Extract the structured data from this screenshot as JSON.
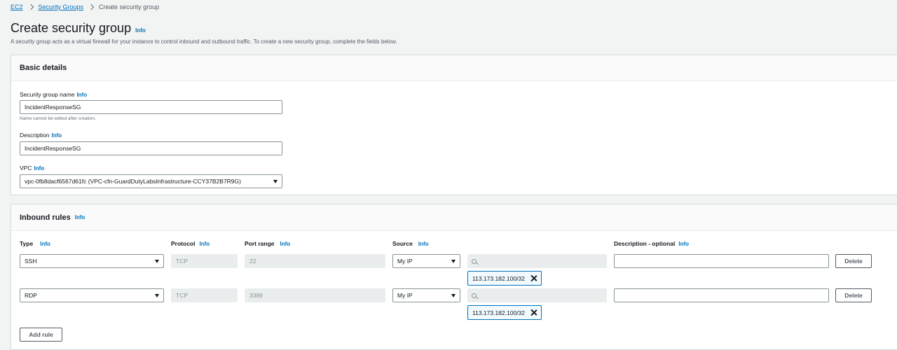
{
  "breadcrumb": {
    "ec2": "EC2",
    "security_groups": "Security Groups",
    "current": "Create security group"
  },
  "page": {
    "title": "Create security group",
    "title_info": "Info",
    "description": "A security group acts as a virtual firewall for your instance to control inbound and outbound traffic. To create a new security group, complete the fields below."
  },
  "basic_details": {
    "header": "Basic details",
    "name_label": "Security group name",
    "name_info": "Info",
    "name_value": "IncidentResponseSG",
    "name_hint": "Name cannot be edited after creation.",
    "desc_label": "Description",
    "desc_info": "Info",
    "desc_value": "IncidentResponseSG",
    "vpc_label": "VPC",
    "vpc_info": "Info",
    "vpc_value": "vpc-0fb8dacf6567d61fc (VPC-cfn-GuardDutyLabsInfrastructure-CCY37B2B7R9G)"
  },
  "inbound": {
    "header": "Inbound rules",
    "header_info": "Info",
    "columns": {
      "type": "Type",
      "protocol": "Protocol",
      "port_range": "Port range",
      "source": "Source",
      "description": "Description - optional",
      "info": "Info"
    },
    "rules": [
      {
        "type": "SSH",
        "protocol": "TCP",
        "port": "22",
        "source": "My IP",
        "cidr": "113.173.182.100/32",
        "description": "",
        "delete": "Delete"
      },
      {
        "type": "RDP",
        "protocol": "TCP",
        "port": "3389",
        "source": "My IP",
        "cidr": "113.173.182.100/32",
        "description": "",
        "delete": "Delete"
      }
    ],
    "add_rule": "Add rule"
  },
  "colors": {
    "link": "#0073bb",
    "background": "#f2f3f3",
    "panel": "#ffffff",
    "disabled": "#eaeded"
  }
}
